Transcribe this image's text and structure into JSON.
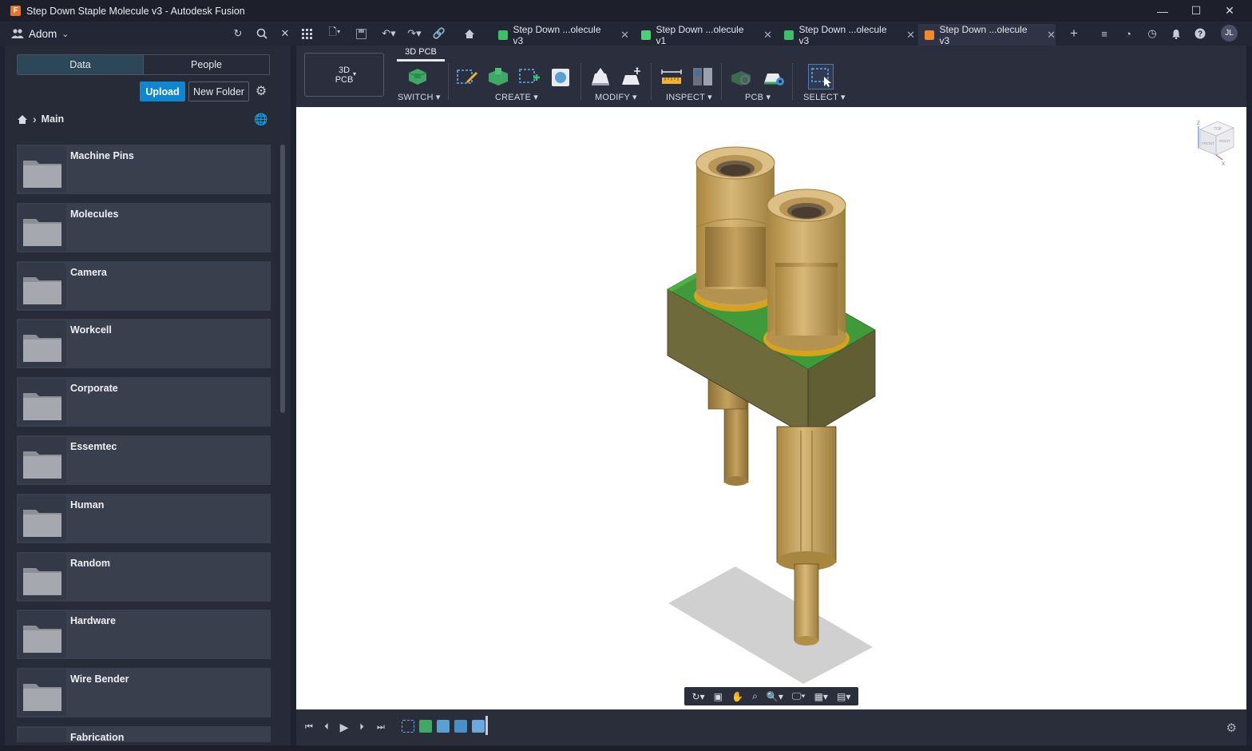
{
  "window": {
    "title": "Step Down Staple Molecule v3 - Autodesk Fusion",
    "app_icon_letter": "F",
    "minimize": "—",
    "maximize": "☐",
    "close": "✕"
  },
  "appbar": {
    "team_name": "Adom",
    "avatar_initials": "JL",
    "tabs": [
      {
        "label": "Step Down ...olecule v3",
        "icon_color": "#3fbf6a",
        "active": false
      },
      {
        "label": "Step Down ...olecule v1",
        "icon_color": "#4ccf77",
        "active": false
      },
      {
        "label": "Step Down ...olecule v3",
        "icon_color": "#3fbf6a",
        "active": false
      },
      {
        "label": "Step Down ...olecule v3",
        "icon_color": "#f08a2a",
        "active": true
      }
    ]
  },
  "datapanel": {
    "tab_data": "Data",
    "tab_people": "People",
    "upload_label": "Upload",
    "new_folder_label": "New Folder",
    "breadcrumb_current": "Main",
    "folders": [
      "Machine Pins",
      "Molecules",
      "Camera",
      "Workcell",
      "Corporate",
      "Essemtec",
      "Human",
      "Random",
      "Hardware",
      "Wire Bender",
      "Fabrication"
    ]
  },
  "toolbar": {
    "workspace_label_line1": "3D",
    "workspace_label_line2": "PCB",
    "active_tab": "3D PCB",
    "groups": {
      "switch": "SWITCH",
      "create": "CREATE",
      "modify": "MODIFY",
      "inspect": "INSPECT",
      "pcb": "PCB",
      "select": "SELECT"
    }
  },
  "viewcube": {
    "top": "TOP",
    "front": "FRONT",
    "right": "RIGHT",
    "axis_z": "Z",
    "axis_x": "X"
  },
  "colors": {
    "accent": "#0e87d0",
    "board_green": "#3f9a3a",
    "pin_gold": "#c9a45c",
    "body_olive": "#6e6a3c"
  }
}
